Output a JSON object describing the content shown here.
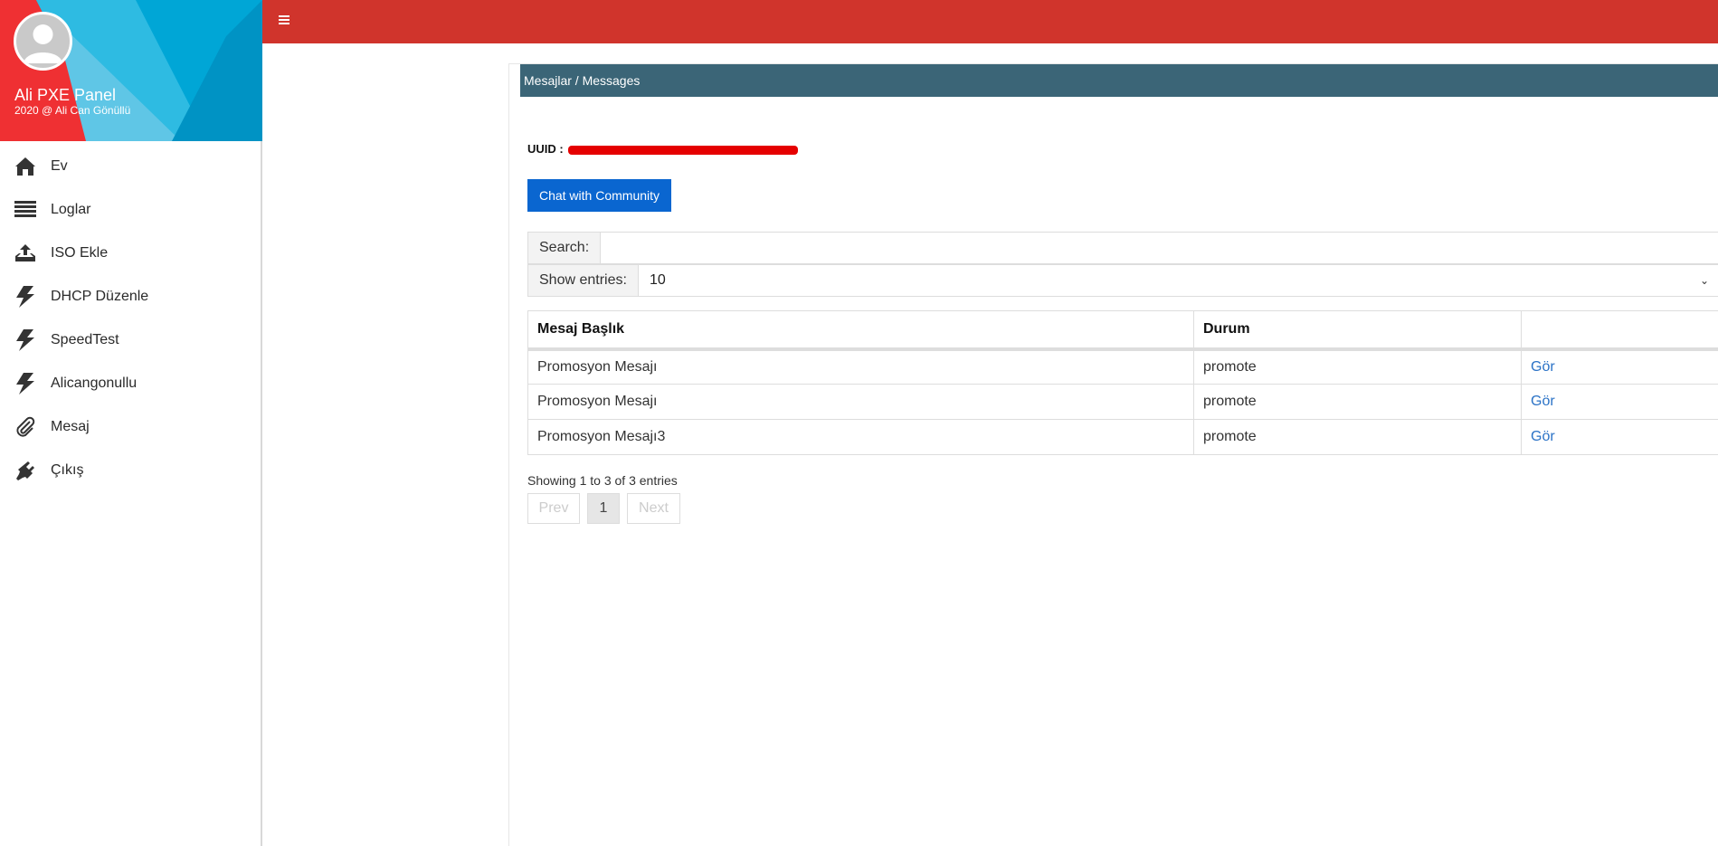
{
  "sidebar": {
    "brand_title": "Ali PXE Panel",
    "brand_sub": "2020 @ Ali Can Gönüllü",
    "items": [
      {
        "label": "Ev",
        "icon": "home-icon"
      },
      {
        "label": "Loglar",
        "icon": "list-icon"
      },
      {
        "label": "ISO Ekle",
        "icon": "upload-icon"
      },
      {
        "label": "DHCP Düzenle",
        "icon": "bolt-icon"
      },
      {
        "label": "SpeedTest",
        "icon": "bolt-icon"
      },
      {
        "label": "Alicangonullu",
        "icon": "bolt-icon"
      },
      {
        "label": "Mesaj",
        "icon": "paperclip-icon"
      },
      {
        "label": "Çıkış",
        "icon": "plug-icon"
      }
    ]
  },
  "topbar": {
    "menu_icon": "hamburger-icon",
    "color": "#d0342c"
  },
  "panel": {
    "title": "Mesajlar / Messages",
    "uuid_label": "UUID :",
    "chat_button": "Chat with Community",
    "search_label": "Search:",
    "search_value": "",
    "entries_label": "Show entries:",
    "entries_value": "10",
    "columns": [
      "Mesaj Başlık",
      "Durum",
      ""
    ],
    "rows": [
      {
        "title": "Promosyon Mesajı",
        "status": "promote",
        "action": "Gör"
      },
      {
        "title": "Promosyon Mesajı",
        "status": "promote",
        "action": "Gör"
      },
      {
        "title": "Promosyon Mesajı3",
        "status": "promote",
        "action": "Gör"
      }
    ],
    "showing": "Showing 1 to 3 of 3 entries",
    "pager": {
      "prev": "Prev",
      "current": "1",
      "next": "Next"
    }
  }
}
